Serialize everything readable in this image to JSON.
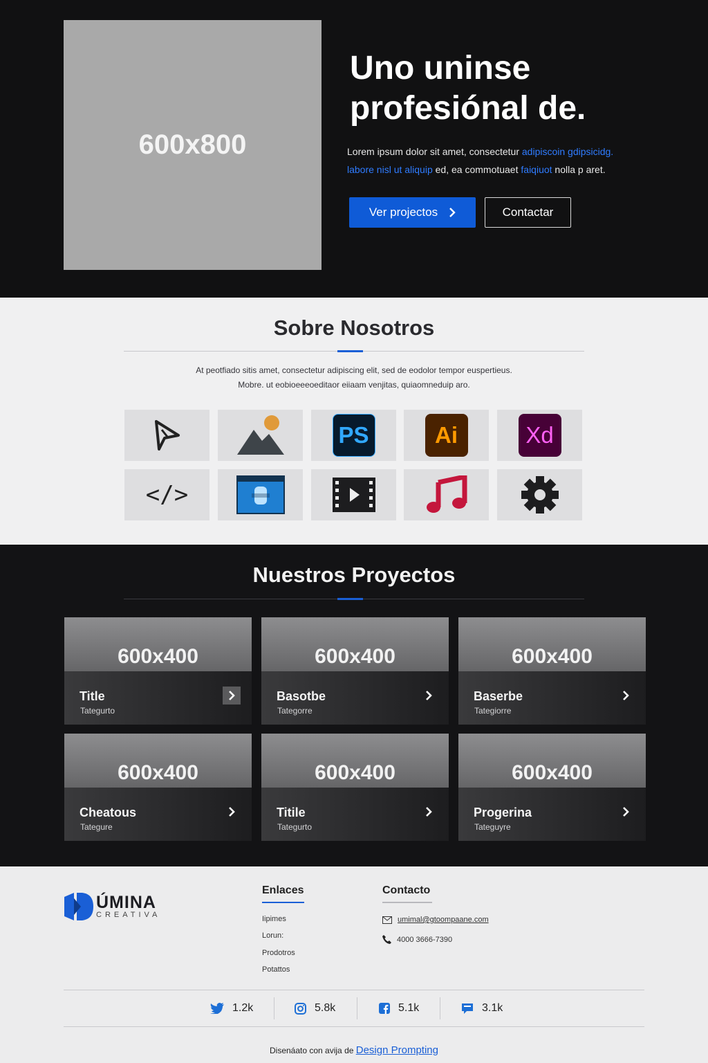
{
  "hero": {
    "image_placeholder": "600x800",
    "title_line1": "Uno uninse",
    "title_line2": "profesiónal de.",
    "text_line1_plain": "Lorem ipsum dolor sit amet, consectetur ",
    "text_line1_link": "adipiscoin gdipsicidg.",
    "text_line2_link": "labore nisl ut aliquip",
    "text_line2_plain": " ed, ea commotuaet ",
    "text_line2_link2": "faiqiuot",
    "text_line2_end": " nolla p aret.",
    "primary_button": "Ver projectos",
    "secondary_button": "Contactar",
    "accent_color": "#0f5bd7"
  },
  "about": {
    "title": "Sobre Nosotros",
    "text_line1": "At peotfiado sitis amet, consectetur adipiscing elit, sed de eodolor tempor euspertieus.",
    "text_line2": "Mobre. ut eobioeeeoeditaor eiiaam venjitas, quiaomneduip aro.",
    "tools": [
      {
        "icon": "pen-tool-icon"
      },
      {
        "icon": "image-icon"
      },
      {
        "icon": "photoshop-icon",
        "label": "PS"
      },
      {
        "icon": "illustrator-icon",
        "label": "Ai"
      },
      {
        "icon": "xd-icon",
        "label": "Xd"
      },
      {
        "icon": "code-icon",
        "label": "</>"
      },
      {
        "icon": "browser-window-icon"
      },
      {
        "icon": "film-icon"
      },
      {
        "icon": "music-icon"
      },
      {
        "icon": "gear-icon"
      }
    ]
  },
  "projects": {
    "title": "Nuestros Proyectos",
    "cards": [
      {
        "placeholder": "600x400",
        "title": "Title",
        "category": "Tategurto"
      },
      {
        "placeholder": "600x400",
        "title": "Basotbe",
        "category": "Tategorre"
      },
      {
        "placeholder": "600x400",
        "title": "Baserbe",
        "category": "Tategiorre"
      },
      {
        "placeholder": "600x400",
        "title": "Cheatous",
        "category": "Tategure"
      },
      {
        "placeholder": "600x400",
        "title": "Titile",
        "category": "Tategurto"
      },
      {
        "placeholder": "600x400",
        "title": "Progerina",
        "category": "Tateguyre"
      }
    ]
  },
  "footer": {
    "logo_word": "ÚMINA",
    "logo_sub": "CREATIVA",
    "links_title": "Enlaces",
    "links": [
      "Iipimes",
      "Lorun:",
      "Prodotros",
      "Potattos"
    ],
    "contact_title": "Contacto",
    "email": "umimal@gtoompaane.com",
    "phone": "4000 3666-7390",
    "social": [
      {
        "icon": "twitter-icon",
        "count": "1.2k"
      },
      {
        "icon": "instagram-icon",
        "count": "5.8k"
      },
      {
        "icon": "facebook-icon",
        "count": "5.1k"
      },
      {
        "icon": "chat-icon",
        "count": "3.1k"
      }
    ],
    "credit_text": "Disenáato con avija de ",
    "credit_link": "Design Prompting"
  }
}
